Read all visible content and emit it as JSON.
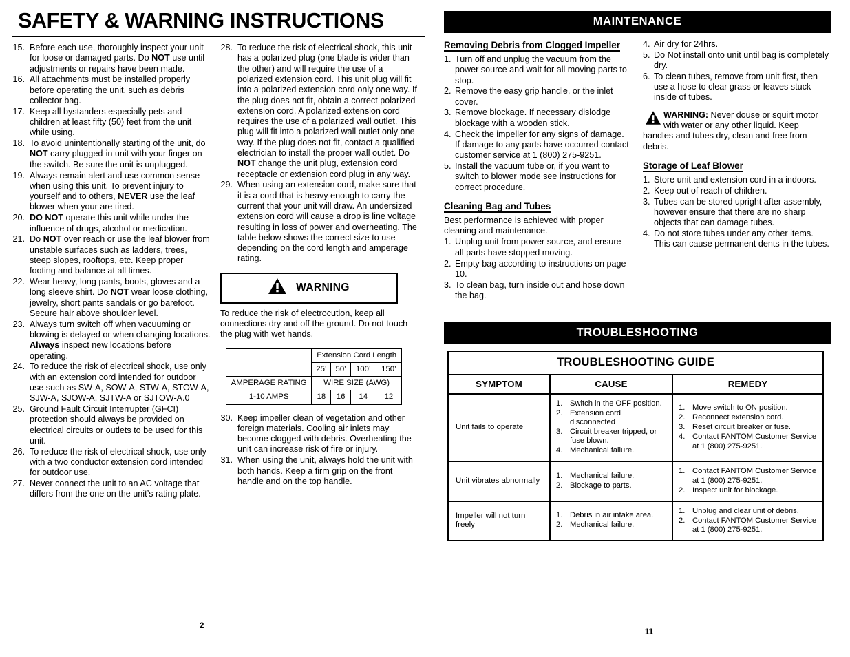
{
  "left_page": {
    "title": "SAFETY & WARNING INSTRUCTIONS",
    "page_number": "2",
    "column1": [
      {
        "num": "15.",
        "text": "Before each use, thoroughly inspect your unit for loose or damaged parts. Do ",
        "bold": "NOT",
        "text2": " use until adjustments or repairs have been made."
      },
      {
        "num": "16.",
        "text": "All attachments must be installed properly before operating the unit, such as debris collector bag."
      },
      {
        "num": "17.",
        "text": "Keep all bystanders especially pets and children at least fifty (50) feet from the unit while using."
      },
      {
        "num": "18.",
        "text": "To avoid unintentionally starting of the unit, do ",
        "bold": "NOT",
        "text2": " carry plugged-in unit with your finger on the switch. Be sure the unit is unplugged."
      },
      {
        "num": "19.",
        "text": "Always remain alert and use common sense when using this unit. To prevent injury to yourself and to others, ",
        "bold": "NEVER",
        "text2": " use the leaf blower when your are tired."
      },
      {
        "num": "20.",
        "text": "",
        "bold": "DO NOT",
        "text2": " operate this unit while under the influence of drugs, alcohol or medication."
      },
      {
        "num": "21.",
        "text": "Do ",
        "bold": "NOT",
        "text2": " over reach or use the leaf blower from unstable surfaces such as ladders, trees, steep slopes, rooftops, etc. Keep proper footing and balance at all times."
      },
      {
        "num": "22.",
        "text": "Wear heavy, long pants, boots, gloves and a long sleeve shirt. Do ",
        "bold": "NOT",
        "text2": " wear loose clothing, jewelry, short pants sandals or go barefoot. Secure hair above shoulder level."
      },
      {
        "num": "23.",
        "text": "Always turn switch off when vacuuming or blowing is delayed or when changing locations.  ",
        "bold": "Always",
        "text2": " inspect new locations before operating."
      },
      {
        "num": "24.",
        "text": "To reduce the risk of electrical shock, use only with an extension cord intended for outdoor use such as SW-A, SOW-A, STW-A, STOW-A, SJW-A, SJOW-A, SJTW-A or SJTOW-A.0"
      },
      {
        "num": "25.",
        "text": "Ground Fault Circuit Interrupter (GFCI) protection should always be provided on electrical circuits or outlets to be used for this unit."
      },
      {
        "num": "26.",
        "text": "To reduce the risk of electrical shock, use only with a two conductor extension cord intended for outdoor use."
      },
      {
        "num": "27.",
        "text": "Never connect the unit to an AC voltage that differs from the one on the unit’s rating plate."
      }
    ],
    "column2_top": [
      {
        "num": "28.",
        "text": "To reduce the risk of electrical shock, this unit has a polarized plug (one blade is wider than the other) and will require the use of a polarized extension cord. This unit plug will fit into a polarized extension cord only one way. If the plug  does not fit, obtain a correct polarized extension cord. A polarized extension cord requires the use of a polarized wall outlet. This plug will fit into a polarized wall outlet only one way. If the plug does not fit, contact a qualified electrician to install the proper wall outlet. Do ",
        "bold": "NOT",
        "text2": " change the unit plug, extension cord receptacle or extension cord plug in any way."
      },
      {
        "num": "29.",
        "text": "When using an extension cord, make sure that it is a cord that is heavy enough to carry the current that your unit will draw. An undersized extension cord will cause a drop is line voltage resulting in loss of power and overheating. The table below shows the correct size to use depending on the cord length and amperage rating."
      }
    ],
    "warning_box": {
      "icon": "warning-triangle-icon",
      "label": "WARNING",
      "body": "To reduce the risk of electrocution, keep all connections dry and off the ground. Do not touch the plug with wet hands."
    },
    "cord_table": {
      "group_header": "Extension Cord Length",
      "lengths": [
        "25’",
        "50’",
        "100’",
        "150’"
      ],
      "amperage_label": "AMPERAGE RATING",
      "wire_size_label": "WIRE SIZE (AWG)",
      "rows": [
        {
          "rating": "1-10 AMPS",
          "sizes": [
            "18",
            "16",
            "14",
            "12"
          ]
        }
      ]
    },
    "column2_bottom": [
      {
        "num": "30.",
        "text": "Keep impeller clean of  vegetation and other foreign materials. Cooling air inlets may become clogged with debris. Overheating the unit can increase risk of fire or injury."
      },
      {
        "num": "31.",
        "text": "When using the unit, always hold the unit with both hands. Keep a firm grip on the front handle and on the top handle."
      }
    ]
  },
  "right_page": {
    "page_number": "11",
    "maintenance_bar": "MAINTENANCE",
    "troubleshooting_bar": "TROUBLESHOOTING",
    "col1": {
      "heading1": "Removing  Debris from Clogged Impeller",
      "list1": [
        {
          "num": "1.",
          "text": "Turn off and unplug the vacuum from the power source and wait for all moving parts to stop."
        },
        {
          "num": "2.",
          "text": "Remove the easy grip handle, or the inlet cover."
        },
        {
          "num": "3.",
          "text": "Remove blockage. If necessary dislodge blockage with a wooden stick."
        },
        {
          "num": "4.",
          "text": "Check the impeller for any signs of damage. If damage to any parts have occurred contact customer service at 1 (800) 275-9251."
        },
        {
          "num": "5.",
          "text": "Install the vacuum tube or, if you want to switch to blower mode see instructions for correct procedure."
        }
      ],
      "heading2": "Cleaning Bag and Tubes",
      "intro2": "Best performance is achieved with proper cleaning and maintenance.",
      "list2": [
        {
          "num": "1.",
          "text": "Unplug unit from power source, and ensure all parts have stopped moving."
        },
        {
          "num": "2.",
          "text": "Empty bag according to instructions on page 10."
        },
        {
          "num": "3.",
          "text": "To clean bag, turn inside out and hose down the bag."
        }
      ]
    },
    "col2": {
      "list1": [
        {
          "num": "4.",
          "text": "Air dry for 24hrs."
        },
        {
          "num": "5.",
          "text": "Do Not install onto unit until bag is completely dry."
        },
        {
          "num": "6.",
          "text": "To clean tubes, remove from unit first, then use a hose to clear grass or leaves stuck inside of tubes."
        }
      ],
      "warning": {
        "icon": "warning-triangle-icon",
        "label": "WARNING:",
        "text": " Never douse or squirt motor with water or any other liquid. Keep handles and tubes dry, clean and free from debris."
      },
      "heading2": "Storage of Leaf Blower",
      "list2": [
        {
          "num": "1.",
          "text": "Store unit and extension cord  in a indoors."
        },
        {
          "num": "2.",
          "text": "Keep out of reach of children."
        },
        {
          "num": "3.",
          "text": "Tubes can be stored upright after assembly, however ensure that there are no sharp objects that can damage tubes."
        },
        {
          "num": "4.",
          "text": "Do not store tubes under any other items. This can cause permanent dents in the tubes."
        }
      ]
    },
    "troubleshooting_table": {
      "title": "TROUBLESHOOTING GUIDE",
      "headers": [
        "SYMPTOM",
        "CAUSE",
        "REMEDY"
      ],
      "rows": [
        {
          "symptom": "Unit fails to operate",
          "causes": [
            {
              "num": "1.",
              "text": "Switch in the OFF position."
            },
            {
              "num": "2.",
              "text": "Extension cord disconnected"
            },
            {
              "num": "3.",
              "text": "Circuit breaker tripped, or fuse blown."
            },
            {
              "num": "4.",
              "text": "Mechanical failure."
            }
          ],
          "remedies": [
            {
              "num": "1.",
              "text": "Move switch to ON position."
            },
            {
              "num": "2.",
              "text": "Reconnect extension cord."
            },
            {
              "num": "3.",
              "text": "Reset circuit breaker or fuse."
            },
            {
              "num": "4.",
              "text": "Contact FANTOM Customer Service at 1 (800) 275-9251."
            }
          ]
        },
        {
          "symptom": "Unit vibrates abnormally",
          "causes": [
            {
              "num": "1.",
              "text": "Mechanical failure."
            },
            {
              "num": "2.",
              "text": "Blockage to parts."
            }
          ],
          "remedies": [
            {
              "num": "1.",
              "text": "Contact FANTOM Customer Service at 1 (800) 275-9251."
            },
            {
              "num": "2.",
              "text": "Inspect unit for blockage."
            }
          ]
        },
        {
          "symptom": "Impeller will not turn freely",
          "causes": [
            {
              "num": "1.",
              "text": "Debris in air intake area."
            },
            {
              "num": "2.",
              "text": "Mechanical failure."
            }
          ],
          "remedies": [
            {
              "num": "1.",
              "text": "Unplug and clear unit of debris."
            },
            {
              "num": "2.",
              "text": "Contact FANTOM Customer Service at 1 (800) 275-9251."
            }
          ]
        }
      ]
    }
  }
}
